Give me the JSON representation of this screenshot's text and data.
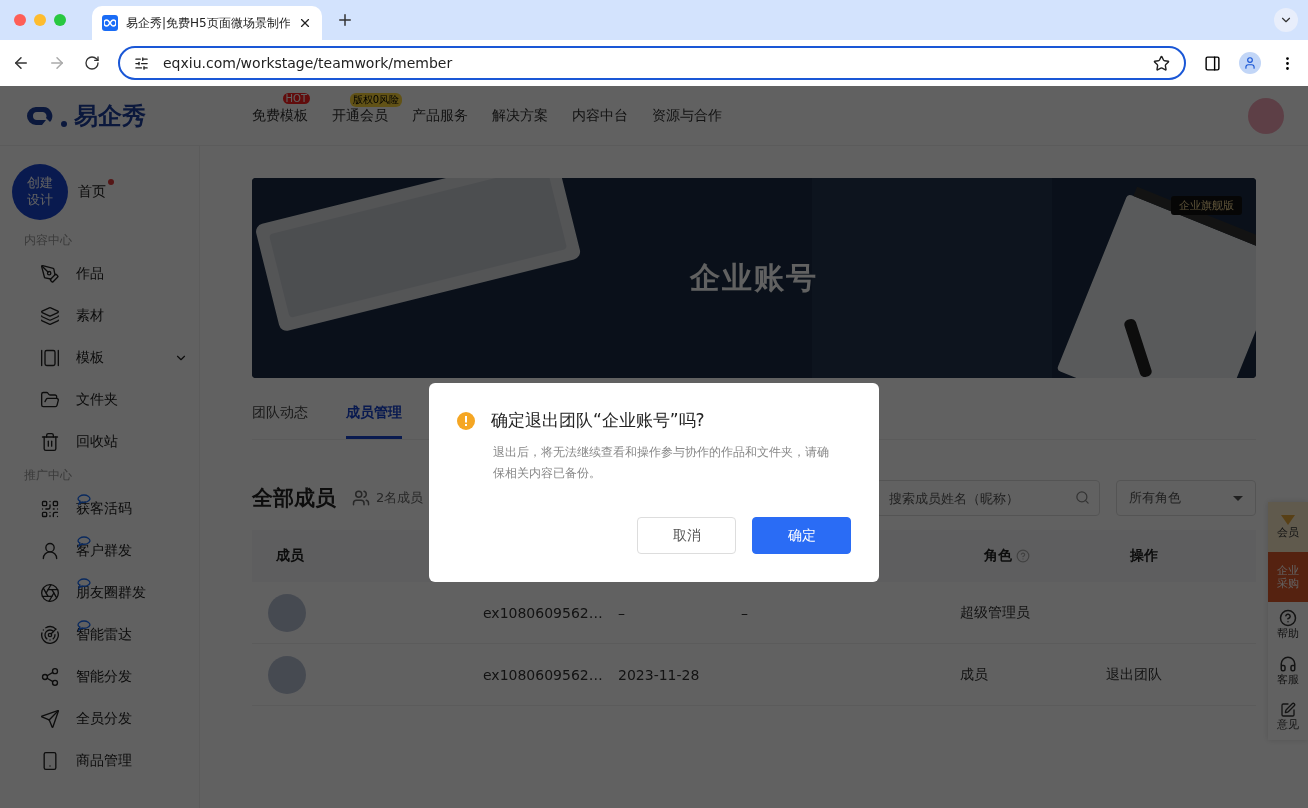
{
  "browser": {
    "tab_title": "易企秀|免费H5页面微场景制作",
    "url": "eqxiu.com/workstage/teamwork/member"
  },
  "header": {
    "logo": "易企秀",
    "nav": [
      {
        "label": "免费模板",
        "badge": "HOT",
        "kind": "hot"
      },
      {
        "label": "开通会员",
        "badge": "版权0风险",
        "kind": "promo"
      },
      {
        "label": "产品服务"
      },
      {
        "label": "解决方案"
      },
      {
        "label": "内容中台"
      },
      {
        "label": "资源与合作"
      }
    ]
  },
  "sidebar": {
    "create_button": [
      "创建",
      "设计"
    ],
    "home": {
      "label": "首页",
      "dot": true
    },
    "sections": [
      {
        "title": "内容中心",
        "items": [
          {
            "label": "作品"
          },
          {
            "label": "素材"
          },
          {
            "label": "模板",
            "expandable": true
          },
          {
            "label": "文件夹"
          },
          {
            "label": "回收站"
          }
        ]
      },
      {
        "title": "推广中心",
        "items": [
          {
            "label": "获客活码",
            "chat_badge": true
          },
          {
            "label": "客户群发",
            "chat_badge": true
          },
          {
            "label": "朋友圈群发",
            "chat_badge": true
          },
          {
            "label": "智能雷达",
            "chat_badge": true
          },
          {
            "label": "智能分发"
          },
          {
            "label": "全员分发"
          },
          {
            "label": "商品管理"
          }
        ]
      }
    ]
  },
  "banner": {
    "title": "企业账号",
    "badge": "企业旗舰版"
  },
  "tabs": [
    {
      "label": "团队动态",
      "selected": false
    },
    {
      "label": "成员管理",
      "selected": true
    }
  ],
  "members": {
    "title": "全部成员",
    "count": "2名成员",
    "search": {
      "placeholder": "搜索成员姓名（昵称）"
    },
    "role_filter": "所有角色"
  },
  "table": {
    "columns": [
      "成员",
      "",
      "",
      "",
      "角色",
      "操作"
    ],
    "rows": [
      {
        "account": "ex1080609562…",
        "date": "–",
        "column_4": "–",
        "role": "超级管理员",
        "action": ""
      },
      {
        "account": "ex1080609562…",
        "date": "2023-11-28",
        "column_4": "",
        "role": "成员",
        "action": "退出团队"
      }
    ]
  },
  "float_bar": [
    {
      "label": "会员",
      "kind": "vip"
    },
    {
      "label": "企业采购",
      "kind": "purchase"
    },
    {
      "label": "帮助",
      "kind": "help"
    },
    {
      "label": "客服",
      "kind": "service"
    },
    {
      "label": "意见",
      "kind": "feedback"
    }
  ],
  "dialog": {
    "title": "确定退出团队“企业账号”吗?",
    "message": "退出后，将无法继续查看和操作参与协作的作品和文件夹，请确保相关内容已备份。",
    "cancel": "取消",
    "confirm": "确定"
  }
}
